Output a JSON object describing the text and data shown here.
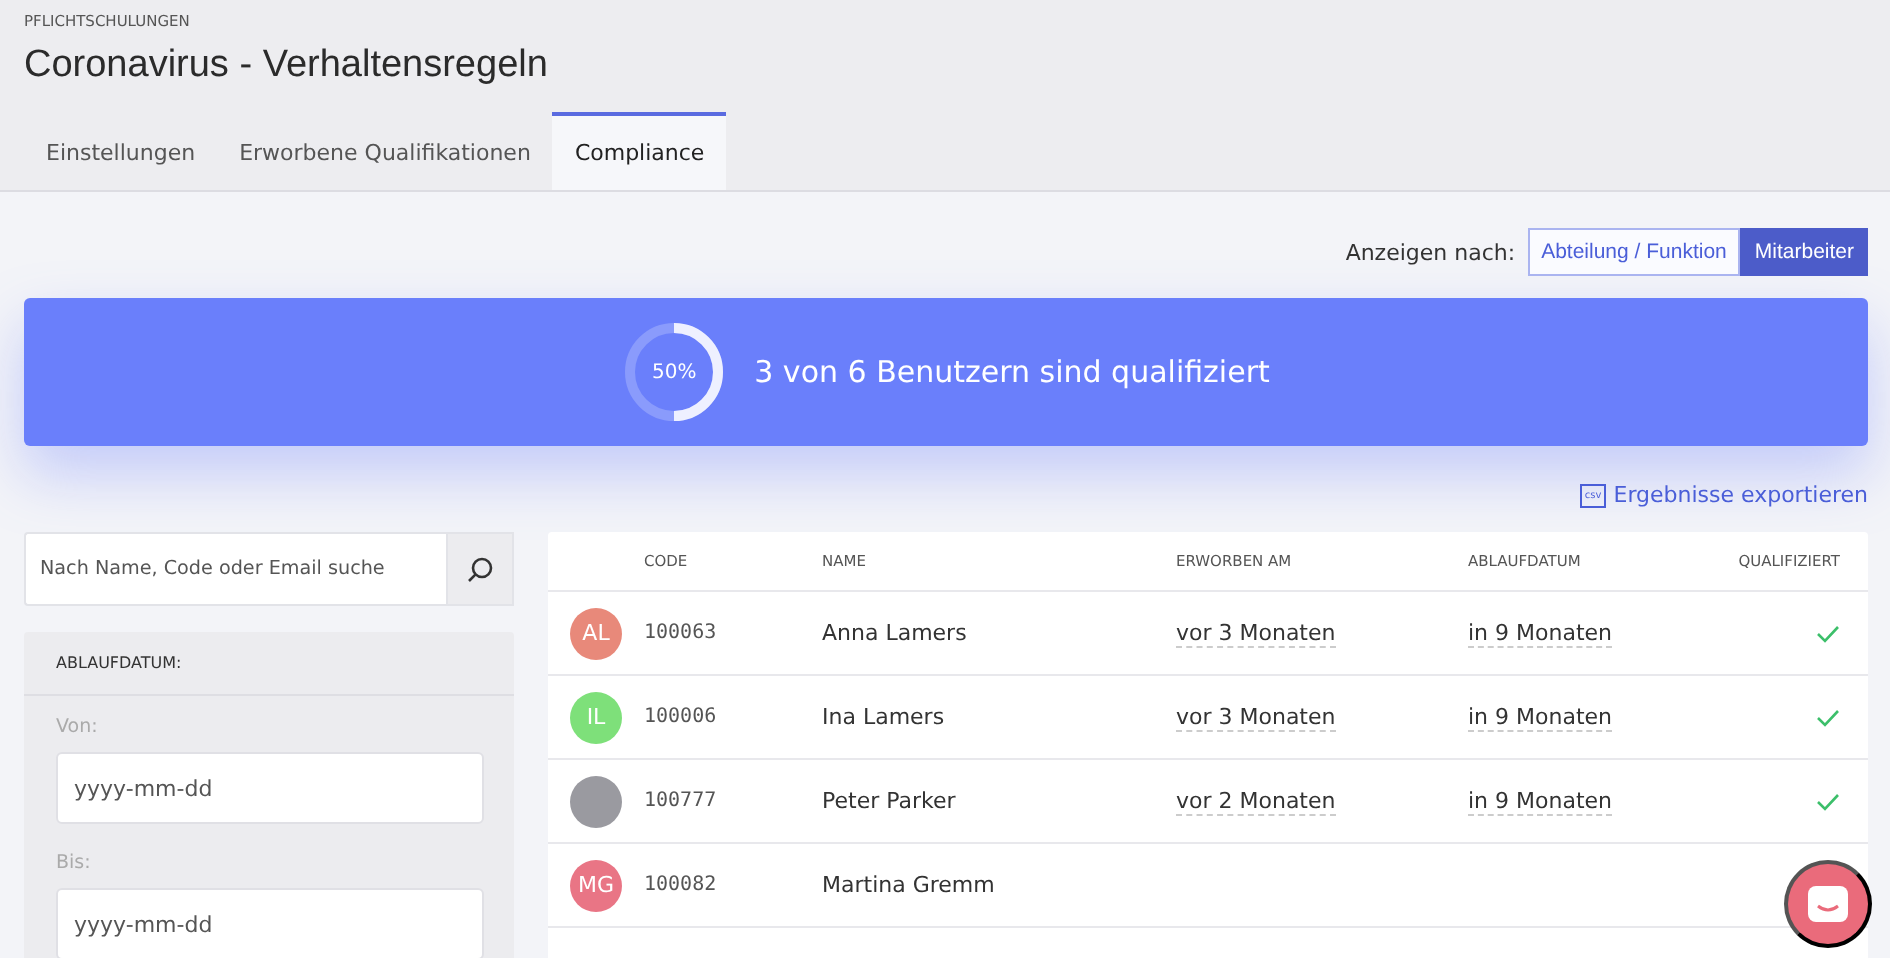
{
  "breadcrumb": "PFLICHTSCHULUNGEN",
  "title": "Coronavirus - Verhaltensregeln",
  "tabs": [
    {
      "label": "Einstellungen",
      "selected": false
    },
    {
      "label": "Erworbene Qualifikationen",
      "selected": false
    },
    {
      "label": "Compliance",
      "selected": true
    }
  ],
  "view_toggle": {
    "label": "Anzeigen nach:",
    "options": [
      {
        "label": "Abteilung / Funktion",
        "selected": false
      },
      {
        "label": "Mitarbeiter",
        "selected": true
      }
    ]
  },
  "summary": {
    "percent": "50%",
    "level": 0.5,
    "text": "3 von 6 Benutzern sind qualifiziert"
  },
  "export_link": {
    "icon_text": "csv",
    "label": "Ergebnisse exportieren"
  },
  "search": {
    "placeholder": "Nach Name, Code oder Email suche"
  },
  "filter": {
    "heading": "ABLAUFDATUM:",
    "fields": [
      {
        "label": "Von:",
        "placeholder": "yyyy-mm-dd"
      },
      {
        "label": "Bis:",
        "placeholder": "yyyy-mm-dd"
      }
    ]
  },
  "table": {
    "columns": [
      "CODE",
      "NAME",
      "ERWORBEN AM",
      "ABLAUFDATUM",
      "QUALIFIZIERT"
    ],
    "rows": [
      {
        "kind": "initials",
        "initials": "AL",
        "color": "#e8897a",
        "code": "100063",
        "name": "Anna Lamers",
        "acquired": "vor 3 Monaten",
        "expires": "in 9 Monaten",
        "qualified": true
      },
      {
        "kind": "initials",
        "initials": "IL",
        "color": "#7ee07a",
        "code": "100006",
        "name": "Ina Lamers",
        "acquired": "vor 3 Monaten",
        "expires": "in 9 Monaten",
        "qualified": true
      },
      {
        "kind": "photo",
        "code": "100777",
        "name": "Peter Parker",
        "acquired": "vor 2 Monaten",
        "expires": "in 9 Monaten",
        "qualified": true
      },
      {
        "kind": "initials",
        "initials": "MG",
        "color": "#e97585",
        "code": "100082",
        "name": "Martina Gremm",
        "qualified": false
      }
    ]
  }
}
